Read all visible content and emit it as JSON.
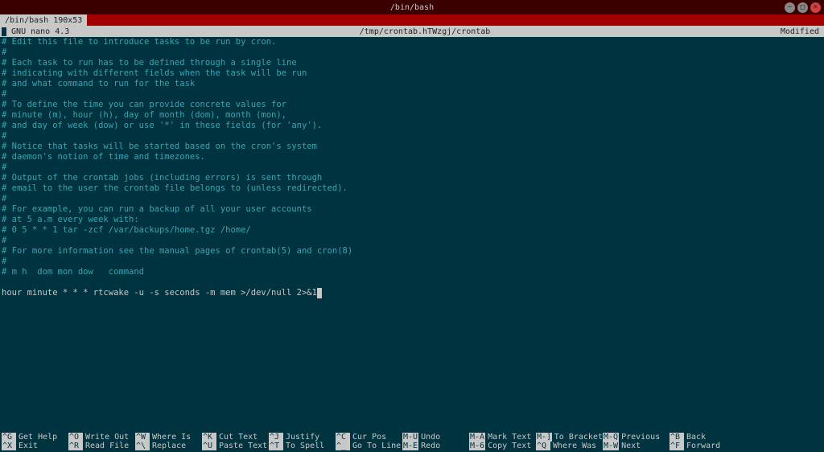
{
  "window": {
    "title": "/bin/bash",
    "tab_label": "/bin/bash 190x53"
  },
  "nano": {
    "version": "GNU nano 4.3",
    "filepath": "/tmp/crontab.hTWzgj/crontab",
    "status": "Modified"
  },
  "editor_lines": [
    {
      "type": "comment",
      "text": "# Edit this file to introduce tasks to be run by cron."
    },
    {
      "type": "comment",
      "text": "#"
    },
    {
      "type": "comment",
      "text": "# Each task to run has to be defined through a single line"
    },
    {
      "type": "comment",
      "text": "# indicating with different fields when the task will be run"
    },
    {
      "type": "comment",
      "text": "# and what command to run for the task"
    },
    {
      "type": "comment",
      "text": "#"
    },
    {
      "type": "comment",
      "text": "# To define the time you can provide concrete values for"
    },
    {
      "type": "comment",
      "text": "# minute (m), hour (h), day of month (dom), month (mon),"
    },
    {
      "type": "comment",
      "text": "# and day of week (dow) or use '*' in these fields (for 'any')."
    },
    {
      "type": "comment",
      "text": "#"
    },
    {
      "type": "comment",
      "text": "# Notice that tasks will be started based on the cron's system"
    },
    {
      "type": "comment",
      "text": "# daemon's notion of time and timezones."
    },
    {
      "type": "comment",
      "text": "#"
    },
    {
      "type": "comment",
      "text": "# Output of the crontab jobs (including errors) is sent through"
    },
    {
      "type": "comment",
      "text": "# email to the user the crontab file belongs to (unless redirected)."
    },
    {
      "type": "comment",
      "text": "#"
    },
    {
      "type": "comment",
      "text": "# For example, you can run a backup of all your user accounts"
    },
    {
      "type": "comment",
      "text": "# at 5 a.m every week with:"
    },
    {
      "type": "comment",
      "text": "# 0 5 * * 1 tar -zcf /var/backups/home.tgz /home/"
    },
    {
      "type": "comment",
      "text": "#"
    },
    {
      "type": "comment",
      "text": "# For more information see the manual pages of crontab(5) and cron(8)"
    },
    {
      "type": "comment",
      "text": "#"
    },
    {
      "type": "comment",
      "text": "# m h  dom mon dow   command"
    },
    {
      "type": "content",
      "text": ""
    },
    {
      "type": "content",
      "text": "hour minute * * * rtcwake -u -s seconds -m mem >/dev/null 2>&1"
    }
  ],
  "shortcuts": {
    "row1": [
      {
        "key": "^G",
        "label": "Get Help"
      },
      {
        "key": "^O",
        "label": "Write Out"
      },
      {
        "key": "^W",
        "label": "Where Is"
      },
      {
        "key": "^K",
        "label": "Cut Text"
      },
      {
        "key": "^J",
        "label": "Justify"
      },
      {
        "key": "^C",
        "label": "Cur Pos"
      },
      {
        "key": "M-U",
        "label": "Undo"
      },
      {
        "key": "M-A",
        "label": "Mark Text"
      },
      {
        "key": "M-]",
        "label": "To Bracket"
      },
      {
        "key": "M-Q",
        "label": "Previous"
      },
      {
        "key": "^B",
        "label": "Back"
      }
    ],
    "row2": [
      {
        "key": "^X",
        "label": "Exit"
      },
      {
        "key": "^R",
        "label": "Read File"
      },
      {
        "key": "^\\",
        "label": "Replace"
      },
      {
        "key": "^U",
        "label": "Paste Text"
      },
      {
        "key": "^T",
        "label": "To Spell"
      },
      {
        "key": "^_",
        "label": "Go To Line"
      },
      {
        "key": "M-E",
        "label": "Redo"
      },
      {
        "key": "M-6",
        "label": "Copy Text"
      },
      {
        "key": "^Q",
        "label": "Where Was"
      },
      {
        "key": "M-W",
        "label": "Next"
      },
      {
        "key": "^F",
        "label": "Forward"
      }
    ]
  }
}
